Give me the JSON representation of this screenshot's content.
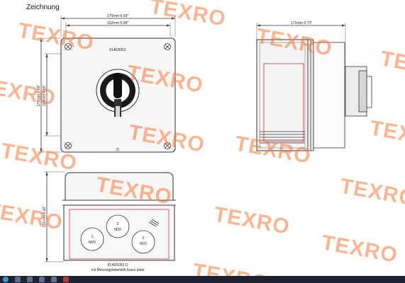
{
  "heading": "Zeichnung",
  "watermark": "TEXRO",
  "front_view": {
    "dim_outer": "170mm   6.69\"",
    "dim_inner": "152mm   5.98\"",
    "dim_height_outer": "170mm   6.69\"",
    "dim_height_inner": "118mm   4.65\"",
    "model_label": "8146/5052",
    "switch_mark": "D"
  },
  "side_view": {
    "dim_depth": "171mm   6.73\""
  },
  "bottom_view": {
    "dim_height": "131mm   5.16\"",
    "glands": [
      {
        "num": "3",
        "size": "M20"
      },
      {
        "num": "1",
        "size": "M20"
      },
      {
        "num": "2",
        "size": "M20"
      }
    ],
    "caption_line1": "8146/5052-D",
    "caption_line2": "mit Messingplatte/with brass plate"
  },
  "colors": {
    "watermark": "#f37a3c",
    "outline": "#333333",
    "red_line": "#d2303a",
    "taskbar": "#1c2230"
  },
  "taskbar": {
    "icons": [
      "start-icon",
      "browser-icon",
      "media-icon",
      "explorer-icon",
      "folder-icon",
      "app-icon"
    ]
  }
}
